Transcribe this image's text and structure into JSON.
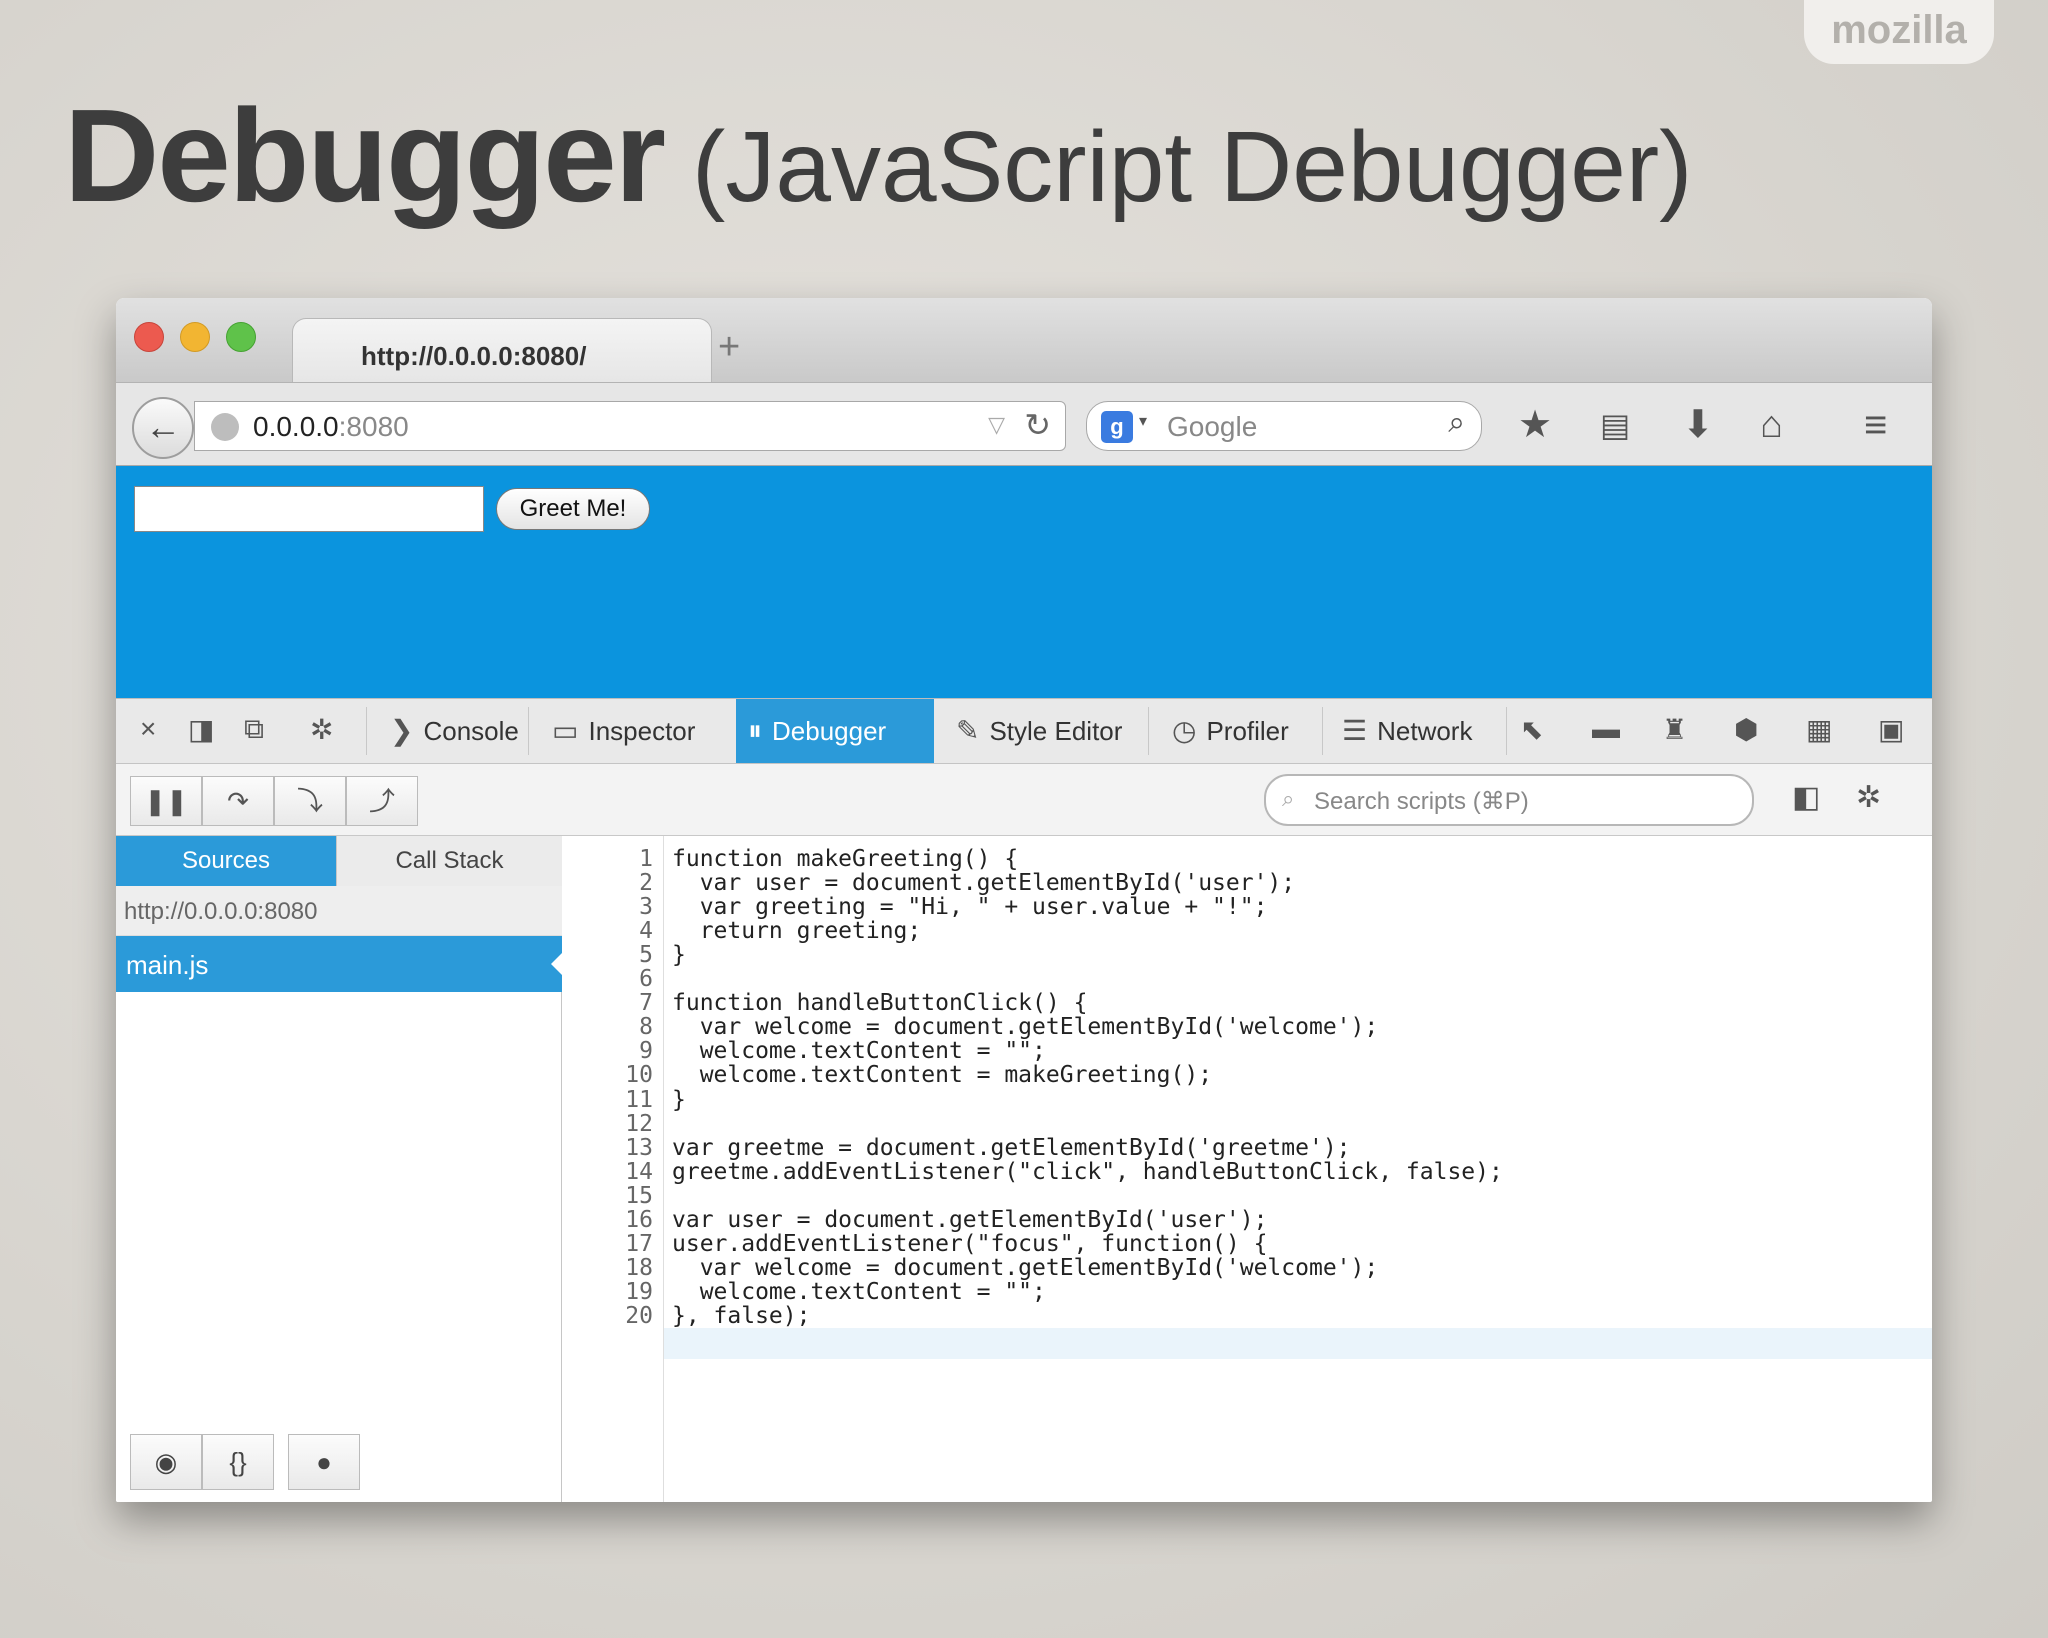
{
  "slide": {
    "brand": "mozilla",
    "title_bold": "Debugger",
    "title_rest": "(JavaScript Debugger)"
  },
  "browser": {
    "tab_title": "http://0.0.0.0:8080/",
    "new_tab": "+",
    "url_host": "0.0.0.0",
    "url_port": ":8080",
    "search_placeholder": "Google"
  },
  "page": {
    "input_value": "",
    "button_label": "Greet Me!",
    "background": "#0b94de"
  },
  "devtools": {
    "tabs": [
      "Console",
      "Inspector",
      "Debugger",
      "Style Editor",
      "Profiler",
      "Network"
    ],
    "active_tab": "Debugger",
    "search_placeholder": "Search scripts (⌘P)",
    "side_tabs": [
      "Sources",
      "Call Stack"
    ],
    "source_group": "http://0.0.0.0:8080",
    "selected_file": "main.js"
  },
  "code_lines": [
    "function makeGreeting() {",
    "  var user = document.getElementById('user');",
    "  var greeting = \"Hi, \" + user.value + \"!\";",
    "  return greeting;",
    "}",
    "",
    "function handleButtonClick() {",
    "  var welcome = document.getElementById('welcome');",
    "  welcome.textContent = \"\";",
    "  welcome.textContent = makeGreeting();",
    "}",
    "",
    "var greetme = document.getElementById('greetme');",
    "greetme.addEventListener(\"click\", handleButtonClick, false);",
    "",
    "var user = document.getElementById('user');",
    "user.addEventListener(\"focus\", function() {",
    "  var welcome = document.getElementById('welcome');",
    "  welcome.textContent = \"\";",
    "}, false);"
  ],
  "line_numbers": [
    "1",
    "2",
    "3",
    "4",
    "5",
    "6",
    "7",
    "8",
    "9",
    "10",
    "11",
    "12",
    "13",
    "14",
    "15",
    "16",
    "17",
    "18",
    "19",
    "20"
  ]
}
